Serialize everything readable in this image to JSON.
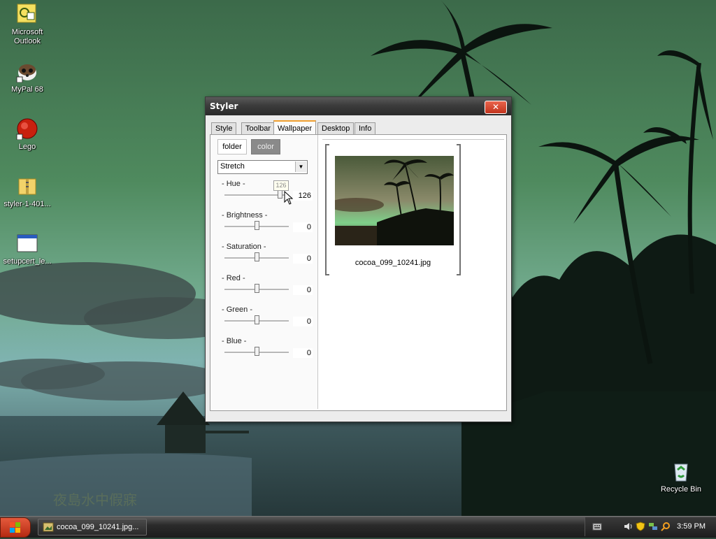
{
  "desktop": {
    "icons": [
      {
        "label": "Microsoft Outlook",
        "icon": "outlook-icon"
      },
      {
        "label": "MyPal 68",
        "icon": "mypal-icon"
      },
      {
        "label": "Lego",
        "icon": "lego-icon"
      },
      {
        "label": "styler-1-401...",
        "icon": "zip-folder-icon"
      },
      {
        "label": "setupcert_le...",
        "icon": "application-window-icon"
      }
    ],
    "recycle_bin": {
      "label": "Recycle Bin",
      "icon": "recycle-bin-icon"
    }
  },
  "window": {
    "title": "Styler",
    "close_label": "✕",
    "tabs": [
      {
        "label": "Style",
        "active": false
      },
      {
        "label": "Toolbar",
        "active": false
      },
      {
        "label": "Wallpaper",
        "active": true
      },
      {
        "label": "Desktop",
        "active": false
      },
      {
        "label": "Info",
        "active": false
      }
    ],
    "wallpaper": {
      "folder_label": "folder",
      "color_label": "color",
      "mode_select": "Stretch",
      "sliders": [
        {
          "label": "- Hue -",
          "value": "126",
          "fraction": 0.86
        },
        {
          "label": "- Brightness -",
          "value": "0",
          "fraction": 0.5
        },
        {
          "label": "- Saturation -",
          "value": "0",
          "fraction": 0.5
        },
        {
          "label": "- Red -",
          "value": "0",
          "fraction": 0.5
        },
        {
          "label": "- Green -",
          "value": "0",
          "fraction": 0.5
        },
        {
          "label": "- Blue -",
          "value": "0",
          "fraction": 0.5
        }
      ],
      "hue_tooltip": "126",
      "preview_caption": "cocoa_099_10241.jpg"
    }
  },
  "taskbar": {
    "start_icon": "windows-logo-icon",
    "task_item": "cocoa_099_10241.jpg...",
    "clock": "3:59 PM"
  },
  "colors": {
    "accent_tab": "#f0a030",
    "close_button": "#d4472d",
    "start_button": "#c8361a"
  }
}
